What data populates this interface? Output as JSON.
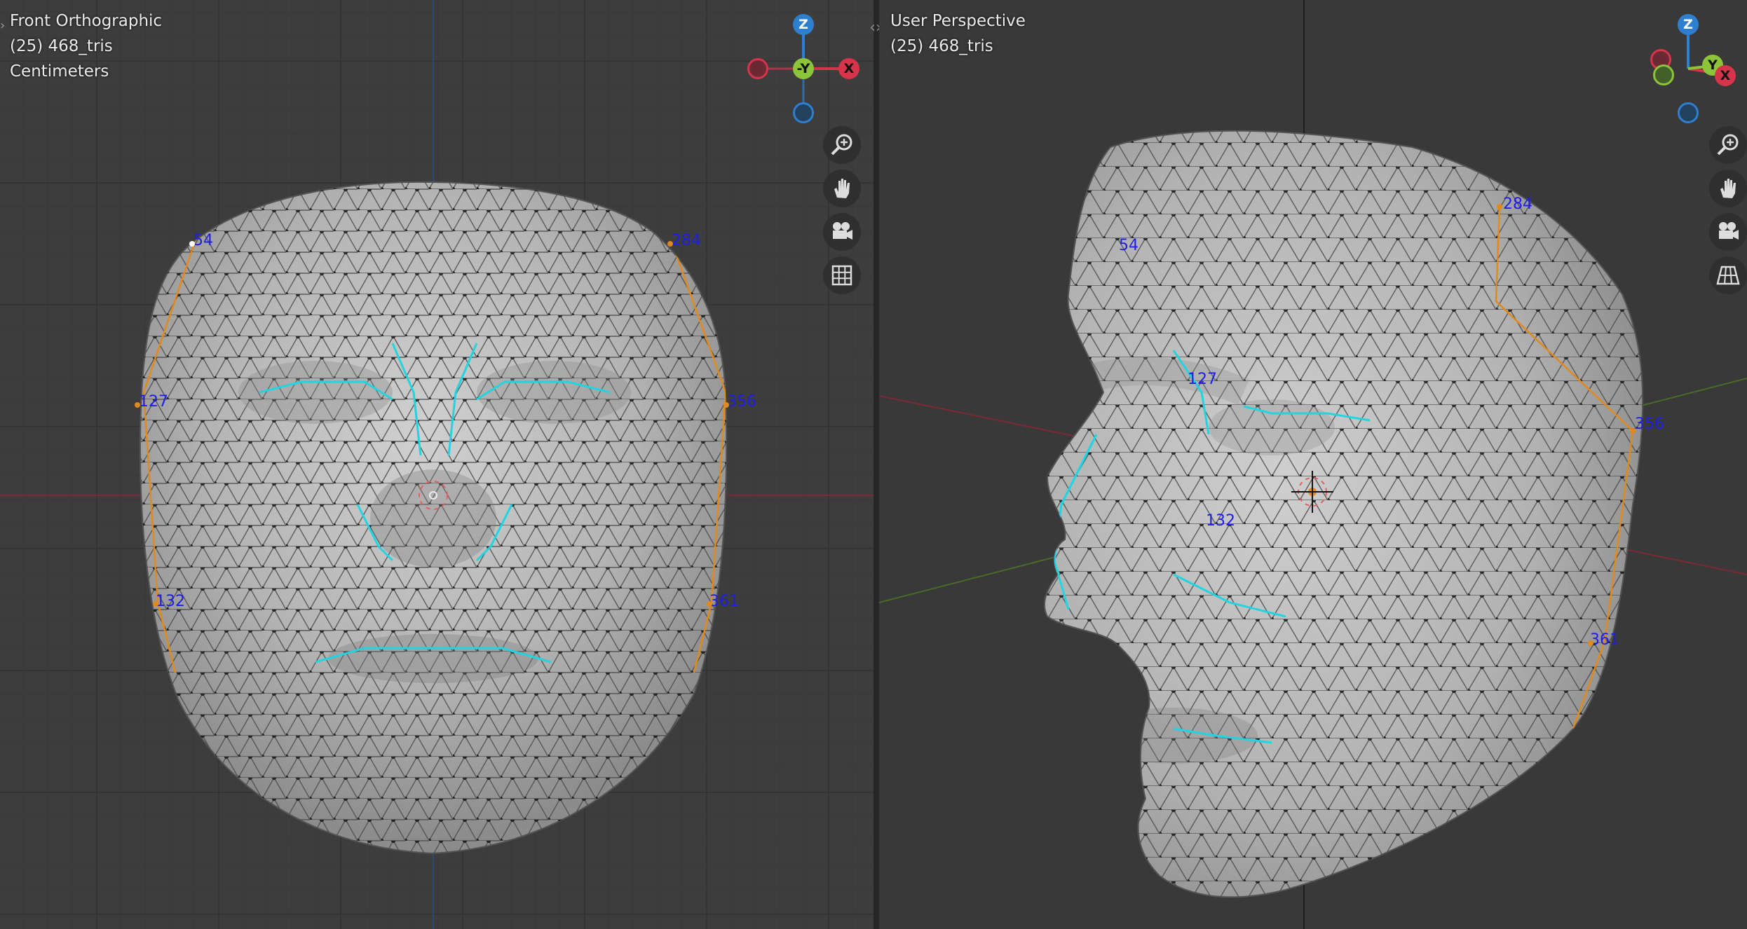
{
  "left_viewport": {
    "view_name": "Front Orthographic",
    "object_info": "(25) 468_tris",
    "units": "Centimeters",
    "vertex_labels": [
      "54",
      "284",
      "127",
      "356",
      "132",
      "361"
    ],
    "gizmo": {
      "z": "Z",
      "y": "-Y",
      "x": "X"
    }
  },
  "right_viewport": {
    "view_name": "User Perspective",
    "object_info": "(25) 468_tris",
    "vertex_labels": [
      "54",
      "284",
      "127",
      "356",
      "132",
      "361"
    ],
    "gizmo": {
      "z": "Z",
      "y": "Y",
      "x": "X"
    }
  },
  "nav_buttons": [
    "zoom-icon",
    "hand-pan-icon",
    "camera-icon",
    "grid-icon"
  ],
  "colors": {
    "x_axis": "#d6344a",
    "y_axis": "#8cc43a",
    "z_axis": "#2f7fd0",
    "label": "#1e1ee8",
    "seam": "#22d4e0",
    "selected_edge": "#e08a1e"
  }
}
